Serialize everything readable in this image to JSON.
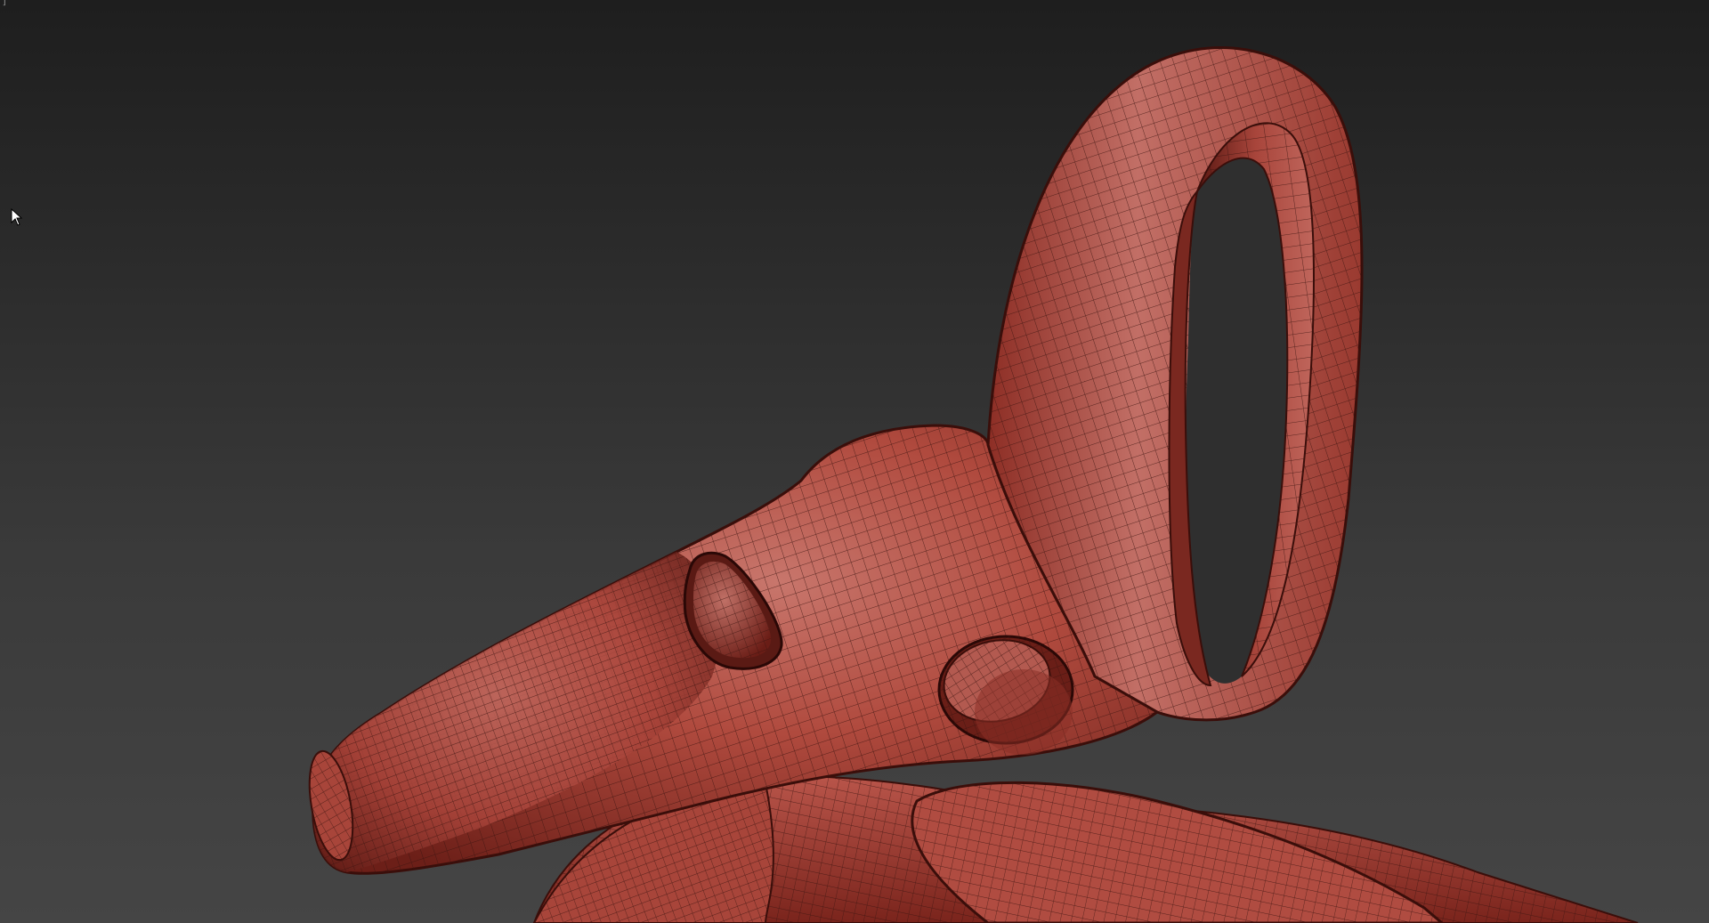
{
  "viewport": {
    "label": "]",
    "background_top": "#1e1e1e",
    "background_bottom": "#454545"
  },
  "model": {
    "object": "stylized-character-head-mesh",
    "base_color": "#b5473a",
    "wire_color": "#3a1410"
  },
  "cursor": {
    "icon": "arrow-cursor-icon"
  }
}
